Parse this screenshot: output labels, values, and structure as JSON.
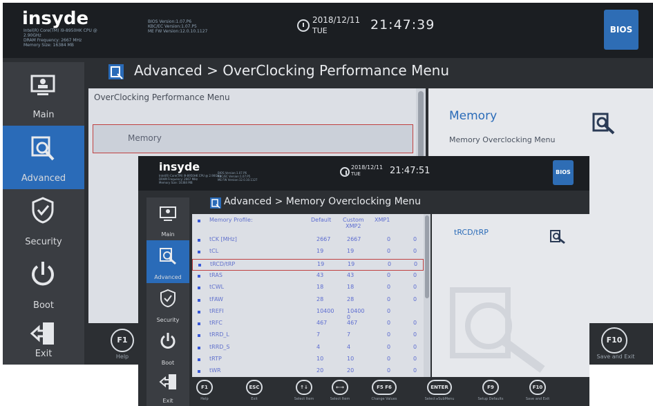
{
  "back": {
    "logo": "insyde",
    "sysinfo": "Intel(R) Core(TM) i9-8950HK CPU @\n2.90GHz\nDRAM Frequency: 2667 MHz\nMemory Size: 16384 MB",
    "fwinfo": "BIOS Version:1.07.P6\nKBC/EC Version:1.07.P5\nME FW Version:12.0.10.1127",
    "date": "2018/12/11",
    "day": "TUE",
    "time": "21:47:39",
    "brand_badge": "Insyde H2O BIOS",
    "brand_text": "BIOS",
    "breadcrumb": "Advanced > OverClocking Performance Menu",
    "panel_header": "OverClocking Performance Menu",
    "selected_item": "Memory",
    "help_title": "Memory",
    "help_text": "Memory Overclocking Menu",
    "sidebar": [
      "Main",
      "Advanced",
      "Security",
      "Boot",
      "Exit"
    ],
    "fkeys": [
      {
        "key": "F1",
        "label": "Help"
      },
      {
        "key": "F10",
        "label": "Save and Exit"
      }
    ]
  },
  "front": {
    "logo": "insyde",
    "sysinfo": "Intel(R) Core(TM) i9-8950HK CPU @ 2.90GHz\nDRAM Frequency: 2667 MHz\nMemory Size: 16384 MB",
    "fwinfo": "BIOS Version:1.07.P6\nKBC/EC Version:1.07.P5\nME FW Version:12.0.10.1127",
    "date": "2018/12/11",
    "day": "TUE",
    "time": "21:47:51",
    "brand_text": "BIOS",
    "breadcrumb": "Advanced > Memory Overclocking Menu",
    "sidebar": [
      "Main",
      "Advanced",
      "Security",
      "Boot",
      "Exit"
    ],
    "table_header": {
      "name": "Memory Profile:",
      "c1": "Default",
      "c2": "Custom\nXMP2",
      "c3": "XMP1"
    },
    "rows": [
      {
        "name": "tCK [MHz]",
        "c1": "2667",
        "c2": "2667",
        "c3": "0",
        "c4": "0"
      },
      {
        "name": "tCL",
        "c1": "19",
        "c2": "19",
        "c3": "0",
        "c4": "0"
      },
      {
        "name": "tRCD/tRP",
        "c1": "19",
        "c2": "19",
        "c3": "0",
        "c4": "0"
      },
      {
        "name": "tRAS",
        "c1": "43",
        "c2": "43",
        "c3": "0",
        "c4": "0"
      },
      {
        "name": "tCWL",
        "c1": "18",
        "c2": "18",
        "c3": "0",
        "c4": "0"
      },
      {
        "name": "tFAW",
        "c1": "28",
        "c2": "28",
        "c3": "0",
        "c4": "0"
      },
      {
        "name": "tREFI",
        "c1": "10400",
        "c2": "10400\n0",
        "c3": "0",
        "c4": ""
      },
      {
        "name": "tRFC",
        "c1": "467",
        "c2": "467",
        "c3": "0",
        "c4": "0"
      },
      {
        "name": "tRRD_L",
        "c1": "7",
        "c2": "7",
        "c3": "0",
        "c4": "0"
      },
      {
        "name": "tRRD_S",
        "c1": "4",
        "c2": "4",
        "c3": "0",
        "c4": "0"
      },
      {
        "name": "tRTP",
        "c1": "10",
        "c2": "10",
        "c3": "0",
        "c4": "0"
      },
      {
        "name": "tWR",
        "c1": "20",
        "c2": "20",
        "c3": "0",
        "c4": "0"
      }
    ],
    "help_title": "tRCD/tRP",
    "fkeys": [
      {
        "key": "F1",
        "label": "Help"
      },
      {
        "key": "ESC",
        "label": "Exit"
      },
      {
        "key": "↑↓",
        "label": "Select Item"
      },
      {
        "key": "←→",
        "label": "Select Item"
      },
      {
        "key": "F5 F6",
        "label": "Change Values"
      },
      {
        "key": "ENTER",
        "label": "Select ▸SubMenu"
      },
      {
        "key": "F9",
        "label": "Setup Defaults"
      },
      {
        "key": "F10",
        "label": "Save and Exit"
      }
    ]
  },
  "colors": {
    "accent": "#2a6bb8",
    "background": "#2c2f33",
    "panel": "#dcdfe5",
    "value_text": "#5b6bd0"
  }
}
